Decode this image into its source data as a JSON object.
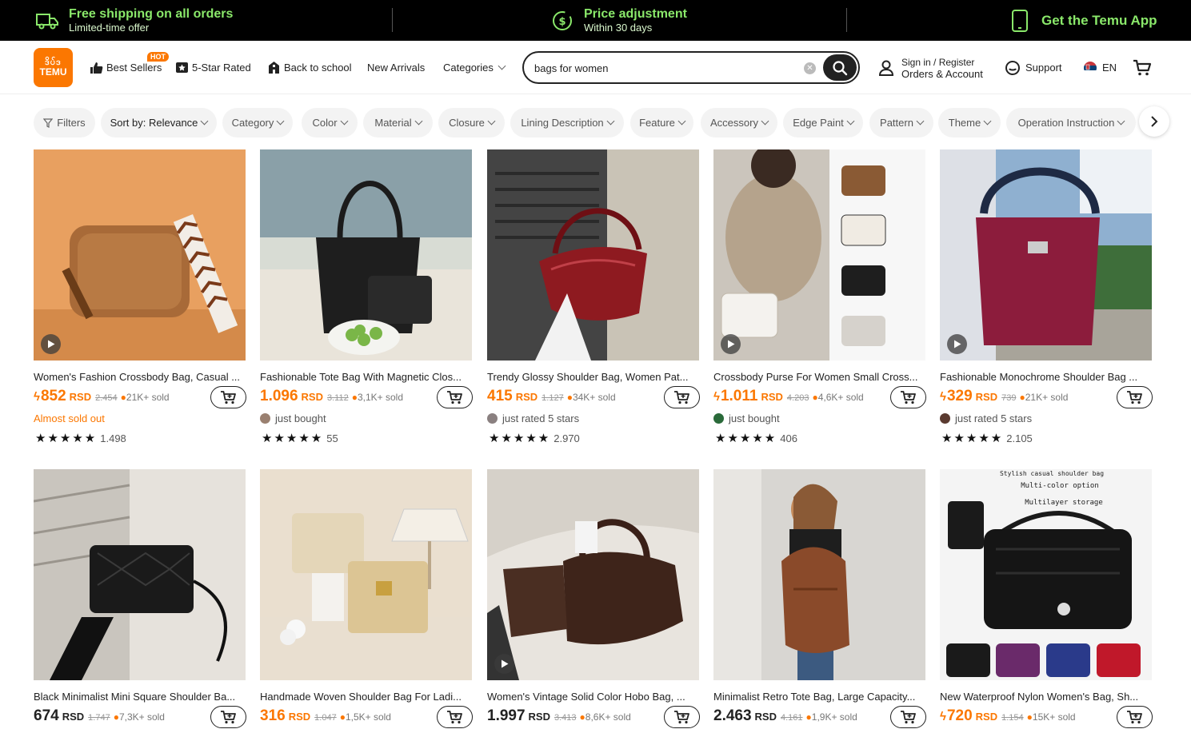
{
  "promo": {
    "shipping_title": "Free shipping on all orders",
    "shipping_sub": "Limited-time offer",
    "price_title": "Price adjustment",
    "price_sub": "Within 30 days",
    "app_label": "Get the Temu App"
  },
  "header": {
    "logo_top": "ဒိပ်ဒ",
    "logo_bottom": "TEMU",
    "nav": {
      "best_sellers": "Best Sellers",
      "hot_badge": "HOT",
      "five_star": "5-Star Rated",
      "back_to_school": "Back to school",
      "new_arrivals": "New Arrivals",
      "categories": "Categories"
    },
    "search_value": "bags for women",
    "account_line1": "Sign in / Register",
    "account_line2": "Orders & Account",
    "support": "Support",
    "language": "EN"
  },
  "filters": {
    "filters_label": "Filters",
    "sort_label": "Sort by: Relevance",
    "items": [
      "Category",
      "Color",
      "Material",
      "Closure",
      "Lining Description",
      "Feature",
      "Accessory",
      "Edge Paint",
      "Pattern",
      "Theme",
      "Operation Instruction"
    ]
  },
  "products": [
    {
      "title": "Women's Fashion Crossbody Bag, Casual ...",
      "price": "852",
      "currency": "RSD",
      "old": "2.454",
      "sold": "21K+ sold",
      "line3": "Almost sold out",
      "rating": "1.498",
      "stars": "★★★★★",
      "lightning": true,
      "has_play": true
    },
    {
      "title": "Fashionable Tote Bag With Magnetic Clos...",
      "price": "1.096",
      "currency": "RSD",
      "old": "3.112",
      "sold": "3,1K+ sold",
      "line3": "just bought",
      "rating": "55",
      "stars": "★★★★★",
      "lightning": false,
      "has_play": false
    },
    {
      "title": "Trendy Glossy Shoulder Bag, Women Pat...",
      "price": "415",
      "currency": "RSD",
      "old": "1.127",
      "sold": "34K+ sold",
      "line3": "just rated 5 stars",
      "rating": "2.970",
      "stars": "★★★★★",
      "lightning": false,
      "has_play": false
    },
    {
      "title": "Crossbody Purse For Women Small Cross...",
      "price": "1.011",
      "currency": "RSD",
      "old": "4.203",
      "sold": "4,6K+ sold",
      "line3": "just bought",
      "rating": "406",
      "stars": "★★★★★",
      "lightning": true,
      "has_play": true
    },
    {
      "title": "Fashionable Monochrome Shoulder Bag ...",
      "price": "329",
      "currency": "RSD",
      "old": "739",
      "sold": "21K+ sold",
      "line3": "just rated 5 stars",
      "rating": "2.105",
      "stars": "★★★★★",
      "lightning": true,
      "has_play": true
    },
    {
      "title": "Black Minimalist Mini Square Shoulder Ba...",
      "price": "674",
      "currency": "RSD",
      "old": "1.747",
      "sold": "7,3K+ sold",
      "lightning": false,
      "has_play": false
    },
    {
      "title": "Handmade Woven Shoulder Bag For Ladi...",
      "price": "316",
      "currency": "RSD",
      "old": "1.047",
      "sold": "1,5K+ sold",
      "lightning": false,
      "has_play": false
    },
    {
      "title": "Women's Vintage Solid Color Hobo Bag, ...",
      "price": "1.997",
      "currency": "RSD",
      "old": "3.413",
      "sold": "8,6K+ sold",
      "lightning": false,
      "has_play": true
    },
    {
      "title": "Minimalist Retro Tote Bag, Large Capacity...",
      "price": "2.463",
      "currency": "RSD",
      "old": "4.161",
      "sold": "1,9K+ sold",
      "lightning": false,
      "has_play": false
    },
    {
      "title": "New Waterproof Nylon Women's Bag, Sh...",
      "price": "720",
      "currency": "RSD",
      "old": "1.154",
      "sold": "15K+ sold",
      "lightning": true,
      "has_play": false
    }
  ],
  "product_image_text": {
    "line1": "Stylish casual shoulder bag",
    "line2": "Multi-color option",
    "line3": "Multilayer storage"
  },
  "colors": {
    "accent_orange": "#fb7701",
    "promo_green": "#8ae86a",
    "promo_bg": "#000000"
  }
}
